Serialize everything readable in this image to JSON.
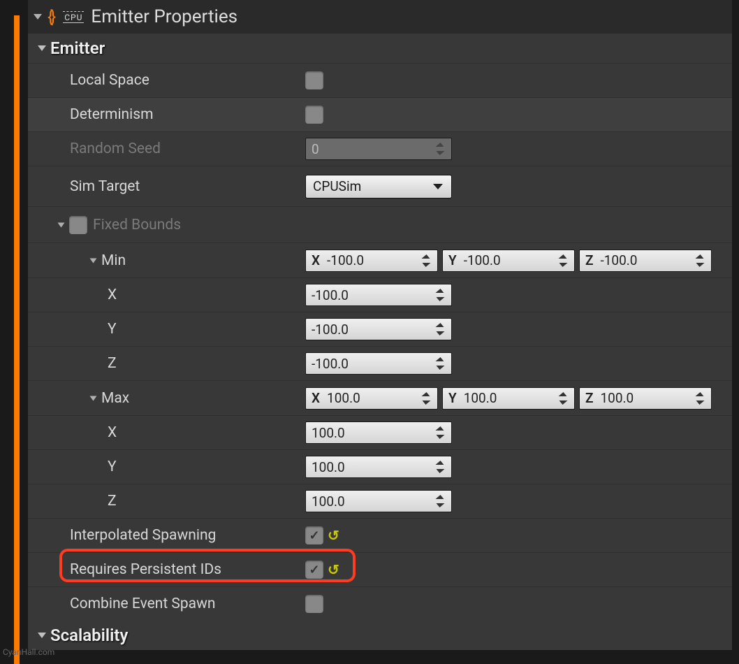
{
  "header": {
    "title": "Emitter Properties",
    "cpu_badge": "CPU"
  },
  "sections": {
    "emitter": {
      "title": "Emitter"
    },
    "scalability": {
      "title": "Scalability"
    }
  },
  "emitter": {
    "local_space": {
      "label": "Local Space",
      "checked": false
    },
    "determinism": {
      "label": "Determinism",
      "checked": false
    },
    "random_seed": {
      "label": "Random Seed",
      "value": "0"
    },
    "sim_target": {
      "label": "Sim Target",
      "value": "CPUSim"
    },
    "fixed_bounds": {
      "label": "Fixed Bounds",
      "checked": false,
      "min": {
        "label": "Min",
        "x": {
          "prefix": "X",
          "value": "-100.0"
        },
        "y": {
          "prefix": "Y",
          "value": "-100.0"
        },
        "z": {
          "prefix": "Z",
          "value": "-100.0"
        },
        "row_x": {
          "label": "X",
          "value": "-100.0"
        },
        "row_y": {
          "label": "Y",
          "value": "-100.0"
        },
        "row_z": {
          "label": "Z",
          "value": "-100.0"
        }
      },
      "max": {
        "label": "Max",
        "x": {
          "prefix": "X",
          "value": "100.0"
        },
        "y": {
          "prefix": "Y",
          "value": "100.0"
        },
        "z": {
          "prefix": "Z",
          "value": "100.0"
        },
        "row_x": {
          "label": "X",
          "value": "100.0"
        },
        "row_y": {
          "label": "Y",
          "value": "100.0"
        },
        "row_z": {
          "label": "Z",
          "value": "100.0"
        }
      }
    },
    "interpolated_spawning": {
      "label": "Interpolated Spawning",
      "checked": true
    },
    "requires_persistent_ids": {
      "label": "Requires Persistent IDs",
      "checked": true
    },
    "combine_event_spawn": {
      "label": "Combine Event Spawn",
      "checked": false
    }
  },
  "watermark": "CyanHall.com"
}
